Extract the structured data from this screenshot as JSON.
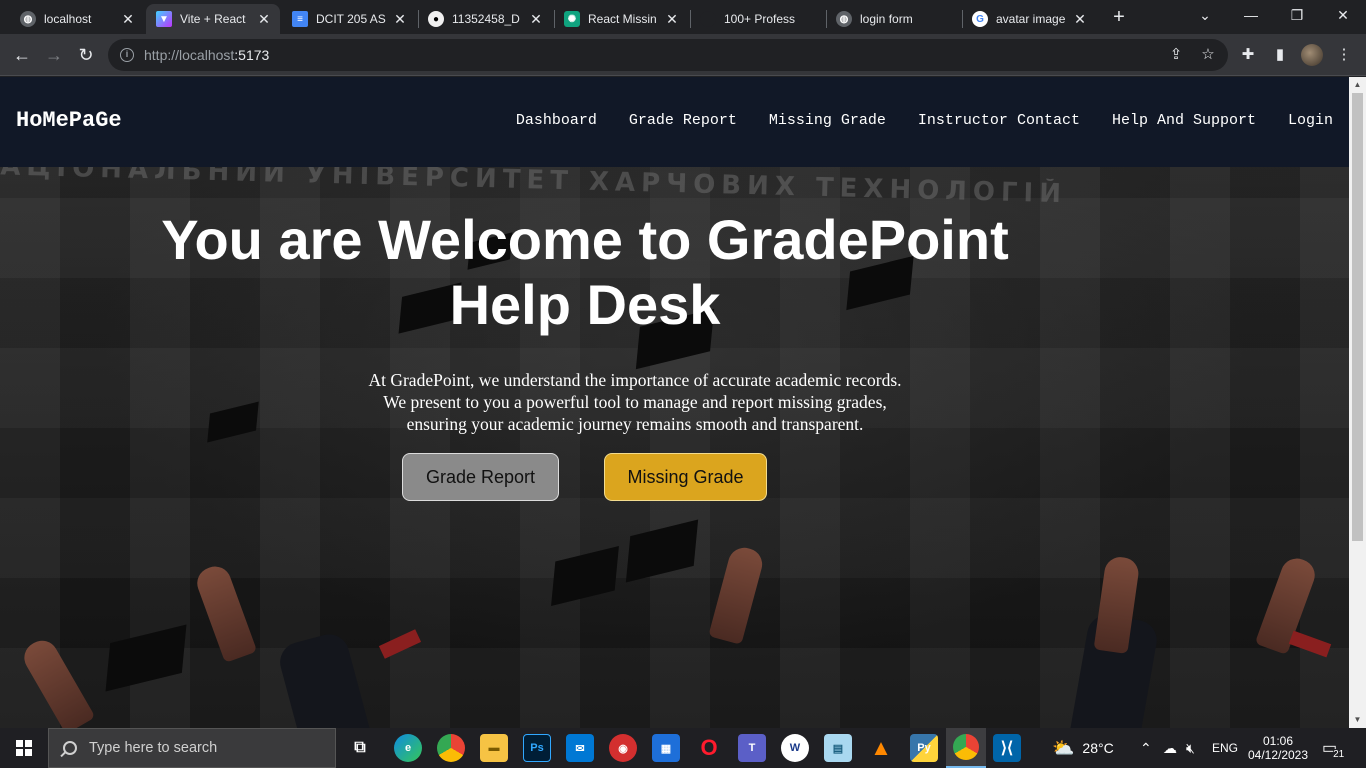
{
  "browser": {
    "tabs": [
      {
        "title": "localhost",
        "icon": "globe-icon",
        "color": "#5f6368"
      },
      {
        "title": "Vite + React",
        "icon": "vite-icon",
        "color": "#a855f7"
      },
      {
        "title": "DCIT 205 AS",
        "icon": "docs-icon",
        "color": "#4285f4"
      },
      {
        "title": "11352458_D",
        "icon": "github-icon",
        "color": "#24292f"
      },
      {
        "title": "React Missin",
        "icon": "chatgpt-icon",
        "color": "#10a37f"
      },
      {
        "title": "100+ Profess",
        "icon": "page-icon",
        "color": "#202124"
      },
      {
        "title": "login form",
        "icon": "globe-icon",
        "color": "#5f6368"
      },
      {
        "title": "avatar image",
        "icon": "google-icon",
        "color": "#ffffff"
      }
    ],
    "url_host": "http://localhost",
    "url_port": ":5173"
  },
  "page": {
    "brand": "HoMePaGe",
    "nav": [
      "Dashboard",
      "Grade Report",
      "Missing Grade",
      "Instructor Contact",
      "Help And Support",
      "Login"
    ],
    "background_text": "АЦІОНАЛЬНИЙ УНІВЕРСИТЕТ ХАРЧОВИХ ТЕХНОЛОГІЙ",
    "hero_title": "You are Welcome to GradePoint Help Desk",
    "hero_line1": "At GradePoint, we understand the importance of accurate academic records.",
    "hero_line2": "We present to you a powerful tool to manage and report missing grades,",
    "hero_line3": "ensuring your academic journey remains smooth and transparent.",
    "btn_grade": "Grade Report",
    "btn_missing": "Missing Grade",
    "colors": {
      "navbar": "#111827",
      "btn_grade": "#8a8a8a",
      "btn_missing": "#dba51e"
    }
  },
  "taskbar": {
    "search_placeholder": "Type here to search",
    "weather": "28°C",
    "lang": "ENG",
    "time": "01:06",
    "date": "04/12/2023",
    "notif_count": "21"
  }
}
